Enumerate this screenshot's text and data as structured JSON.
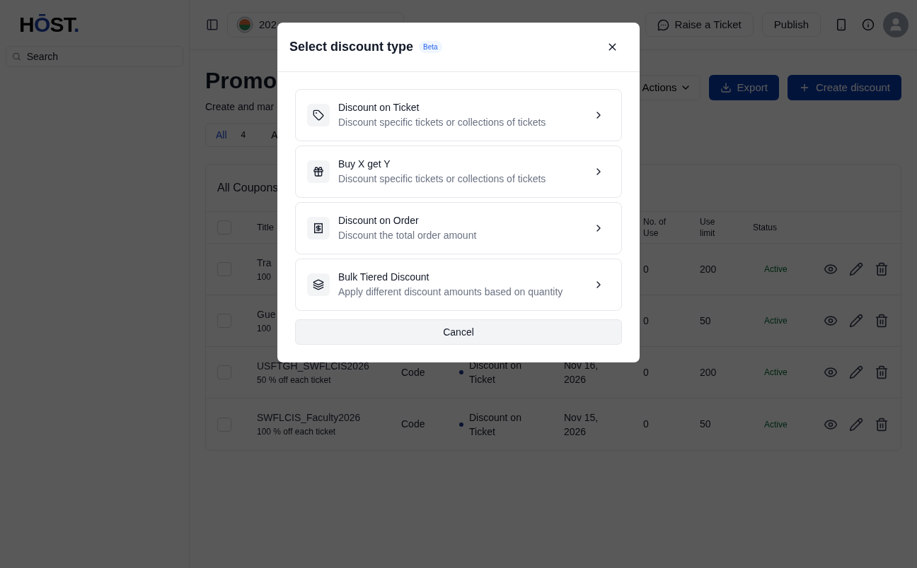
{
  "sidebar": {
    "logo": [
      {
        "text": "H",
        "accent": false
      },
      {
        "text": "Ō",
        "accent": true
      },
      {
        "text": "ST",
        "accent": false
      },
      {
        "text": ".",
        "accent": true
      }
    ],
    "search": {
      "placeholder": "Search"
    }
  },
  "topbar": {
    "event": "202",
    "buttons": [
      {
        "label": "Raise a Ticket",
        "kind": "chat"
      },
      {
        "label": "Publish",
        "kind": "plain"
      }
    ]
  },
  "page": {
    "title": "Promo",
    "subtitle": "Create and mar",
    "actions": [
      {
        "label": "Actions",
        "kind": "menu"
      },
      {
        "label": "Export",
        "kind": "export"
      },
      {
        "label": "Create discount",
        "kind": "create"
      }
    ]
  },
  "tabs": [
    {
      "label": "All",
      "count": "4",
      "selected": true
    },
    {
      "label": "A",
      "selected": false
    }
  ],
  "table": {
    "title": "All Coupons",
    "select_all_checked": false,
    "columns": {
      "title": "Title",
      "uses": "No. of Use",
      "limit": "Use limit",
      "status": "Status"
    },
    "rows": [
      {
        "checked": false,
        "title": "Tra",
        "subtitle": "100",
        "uses": "0",
        "limit": "200",
        "status": "Active"
      },
      {
        "checked": false,
        "title": "Gue",
        "subtitle": "100",
        "uses": "0",
        "limit": "50",
        "status": "Active"
      },
      {
        "checked": false,
        "title": "USFTGH_SWFLCIS2026",
        "subtitle": "50 % off each ticket",
        "type": "Code",
        "discount_type": "Discount on Ticket",
        "expiry": "Nov 16, 2026",
        "uses": "0",
        "limit": "200",
        "status": "Active"
      },
      {
        "checked": false,
        "title": "SWFLCIS_Faculty2026",
        "subtitle": "100 % off each ticket",
        "type": "Code",
        "discount_type": "Discount on Ticket",
        "expiry": "Nov 15, 2026",
        "uses": "0",
        "limit": "50",
        "status": "Active"
      }
    ]
  },
  "modal": {
    "title": "Select discount type",
    "badge": "Beta",
    "options": [
      {
        "kind": "tag",
        "title": "Discount on Ticket",
        "description": "Discount specific tickets or collections of tickets"
      },
      {
        "kind": "gift",
        "title": "Buy X get Y",
        "description": "Discount specific tickets or collections of tickets"
      },
      {
        "kind": "receipt",
        "title": "Discount on Order",
        "description": "Discount the total order amount"
      },
      {
        "kind": "layers",
        "title": "Bulk Tiered Discount",
        "description": "Apply different discount amounts based on quantity"
      }
    ],
    "cancel": "Cancel"
  }
}
